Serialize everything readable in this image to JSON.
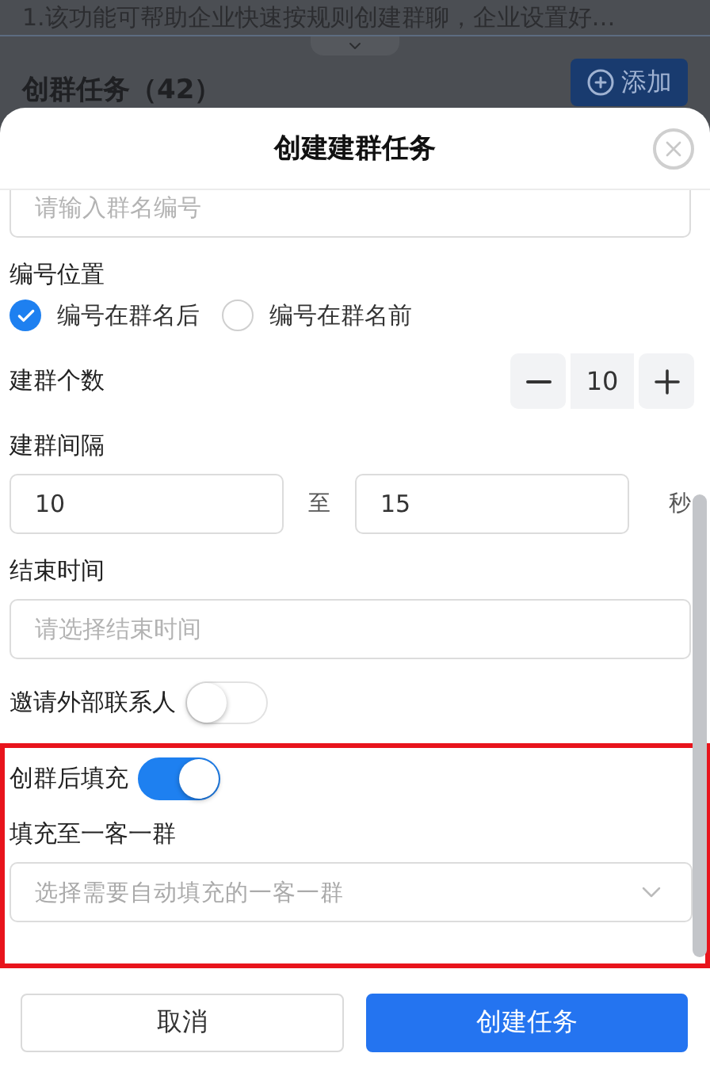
{
  "background": {
    "notice": "1.该功能可帮助企业快速按规则创建群聊，企业设置好…",
    "section_title": "创群任务（42）",
    "add_button": "添加"
  },
  "sheet": {
    "title": "创建建群任务",
    "fields": [
      {
        "kind": "input",
        "placeholder": "请输入群名编号"
      },
      {
        "kind": "radio",
        "label": "编号位置",
        "options": [
          {
            "label": "编号在群名后",
            "selected": true
          },
          {
            "label": "编号在群名前",
            "selected": false
          }
        ]
      },
      {
        "kind": "stepper",
        "label": "建群个数",
        "value": "10"
      },
      {
        "kind": "range",
        "label": "建群间隔",
        "from": "10",
        "separator": "至",
        "to": "15",
        "unit": "秒"
      },
      {
        "kind": "input",
        "label": "结束时间",
        "placeholder": "请选择结束时间"
      },
      {
        "kind": "switch",
        "label": "邀请外部联系人",
        "on": false
      }
    ],
    "highlighted_fields": [
      {
        "kind": "switch",
        "label": "创群后填充",
        "on": true
      },
      {
        "kind": "select",
        "label": "填充至一客一群",
        "placeholder": "选择需要自动填充的一客一群"
      }
    ],
    "buttons": [
      {
        "kind": "secondary",
        "label": "取消"
      },
      {
        "kind": "primary",
        "label": "创建任务"
      }
    ]
  }
}
